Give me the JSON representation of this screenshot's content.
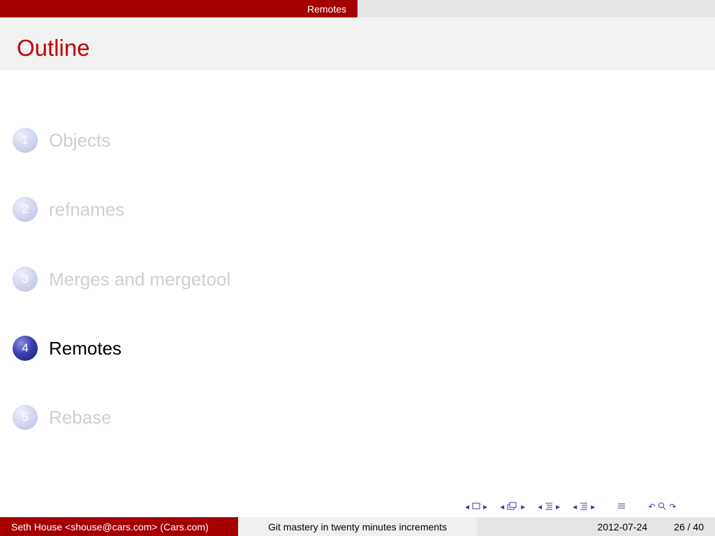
{
  "header": {
    "section": "Remotes"
  },
  "slide": {
    "title": "Outline"
  },
  "outline": [
    {
      "number": "1",
      "label": "Objects"
    },
    {
      "number": "2",
      "label": "refnames"
    },
    {
      "number": "3",
      "label": "Merges and mergetool"
    },
    {
      "number": "4",
      "label": "Remotes"
    },
    {
      "number": "5",
      "label": "Rebase"
    }
  ],
  "current_item": "4",
  "footer": {
    "author": "Seth House <shouse@cars.com>  (Cars.com)",
    "presentation_title": "Git mastery in twenty minutes increments",
    "date": "2012-07-24",
    "page": "26 / 40"
  },
  "icons": {
    "nav": [
      "arrow-left-icon",
      "frame-icon",
      "arrow-right-icon",
      "arrow-left-icon",
      "subsection-icon",
      "arrow-right-icon",
      "arrow-left-icon",
      "section-icon",
      "arrow-right-icon",
      "arrow-left-icon",
      "toc-icon",
      "arrow-right-icon",
      "outline-icon",
      "undo-icon",
      "search-icon",
      "redo-icon"
    ]
  }
}
